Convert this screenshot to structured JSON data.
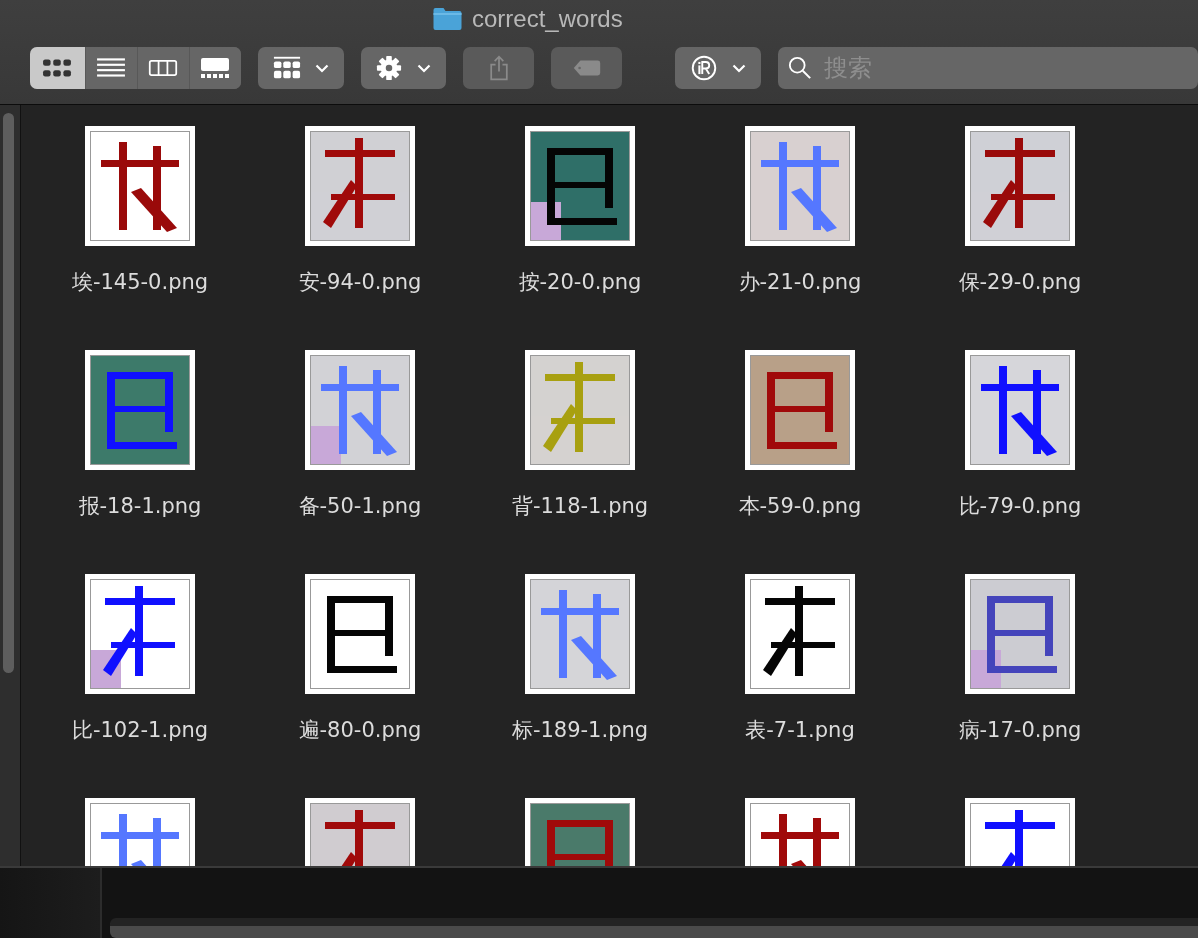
{
  "window": {
    "title": "correct_words"
  },
  "view_modes": [
    {
      "kind": "icons",
      "selected": true
    },
    {
      "kind": "list",
      "selected": false
    },
    {
      "kind": "columns",
      "selected": false
    },
    {
      "kind": "gallery",
      "selected": false
    }
  ],
  "toolbar": [
    {
      "kind": "group",
      "disabled": false
    },
    {
      "kind": "action",
      "disabled": false
    },
    {
      "kind": "share",
      "disabled": true
    },
    {
      "kind": "tag",
      "disabled": true
    },
    {
      "kind": "extension",
      "disabled": false
    }
  ],
  "search": {
    "placeholder": "搜索"
  },
  "files": [
    {
      "name": "埃-145-0.png",
      "kind": "picture"
    },
    {
      "name": "安-94-0.png",
      "kind": "picture"
    },
    {
      "name": "按-20-0.png",
      "kind": "picture"
    },
    {
      "name": "办-21-0.png",
      "kind": "picture"
    },
    {
      "name": "保-29-0.png",
      "kind": "picture"
    },
    {
      "name": "报-18-1.png",
      "kind": "picture"
    },
    {
      "name": "备-50-1.png",
      "kind": "picture"
    },
    {
      "name": "背-118-1.png",
      "kind": "picture"
    },
    {
      "name": "本-59-0.png",
      "kind": "picture"
    },
    {
      "name": "比-79-0.png",
      "kind": "picture"
    },
    {
      "name": "比-102-1.png",
      "kind": "picture"
    },
    {
      "name": "遍-80-0.png",
      "kind": "picture"
    },
    {
      "name": "标-189-1.png",
      "kind": "picture"
    },
    {
      "name": "表-7-1.png",
      "kind": "picture"
    },
    {
      "name": "病-17-0.png",
      "kind": "picture"
    },
    {
      "kind": "picture"
    },
    {
      "kind": "picture"
    },
    {
      "kind": "picture"
    },
    {
      "kind": "picture"
    },
    {
      "kind": "picture"
    }
  ]
}
